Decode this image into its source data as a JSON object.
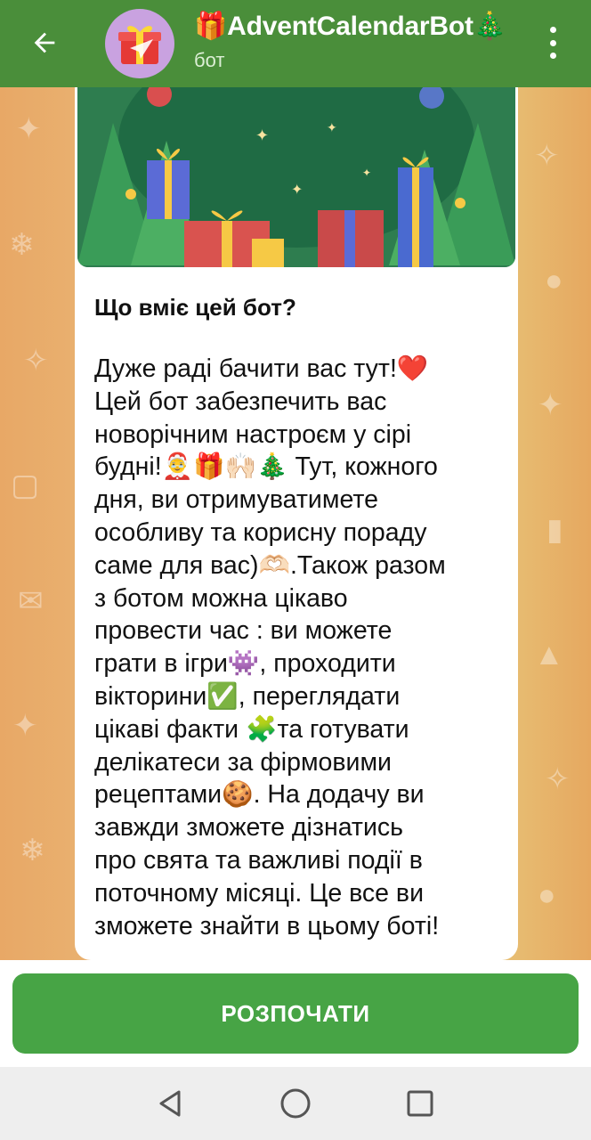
{
  "header": {
    "title": "🎁AdventCalendarBot🎄",
    "subtitle": "бот",
    "back_icon": "arrow-left-icon",
    "menu_icon": "more-vertical-icon",
    "colors": {
      "bar": "#4a8e3a",
      "avatar": "#c9a2e0"
    }
  },
  "message": {
    "title": "Що вміє цей бот?",
    "body": "Дуже раді бачити вас тут!❤️\nЦей бот забезпечить вас\nноворічним настроєм у сірі\nбудні!🤶🎁🙌🏻🎄 Тут, кожного\nдня, ви отримуватимете\nособливу та корисну пораду\nсаме для вас)🫶🏻.Також разом\nз ботом можна цікаво\nпровести час : ви можете\nграти в ігри👾, проходити\nвікторини✅, переглядати\nцікаві факти 🧩та готувати\nделікатеси за фірмовими\nрецептами🍪. На додачу ви\nзавжди зможете дізнатись\nпро свята та важливі події в\nпоточному місяці. Це все ви\nзможете знайти в цьому боті!"
  },
  "start_button": {
    "label": "РОЗПОЧАТИ",
    "color": "#47a445"
  },
  "navbar": {
    "back_icon": "triangle-back-icon",
    "home_icon": "circle-home-icon",
    "recents_icon": "square-recents-icon"
  }
}
